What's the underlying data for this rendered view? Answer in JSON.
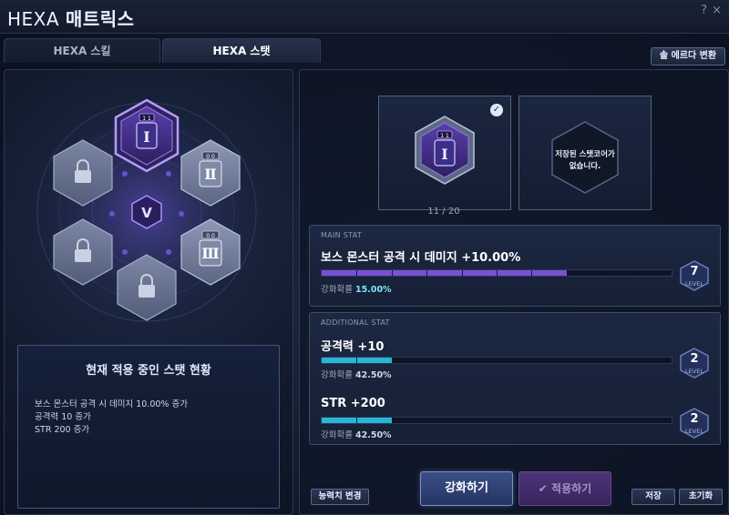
{
  "window": {
    "title_prefix": "HEXA",
    "title_main": "매트릭스",
    "help": "?",
    "close": "×"
  },
  "tabs": [
    {
      "label": "HEXA 스킬",
      "active": false
    },
    {
      "label": "HEXA 스탯",
      "active": true
    }
  ],
  "top_right_button": "솔 에르다 변환",
  "hex_grid": {
    "center_badge": "V",
    "cores": [
      {
        "slot": "top",
        "state": "selected",
        "level_tag": "1 1",
        "numeral": "Ⅰ"
      },
      {
        "slot": "upper-right",
        "state": "unlocked",
        "level_tag": "0 0",
        "numeral": "Ⅱ"
      },
      {
        "slot": "lower-right",
        "state": "unlocked",
        "level_tag": "0 0",
        "numeral": "Ⅲ"
      },
      {
        "slot": "bottom",
        "state": "locked"
      },
      {
        "slot": "lower-left",
        "state": "locked"
      },
      {
        "slot": "upper-left",
        "state": "locked"
      }
    ]
  },
  "status": {
    "title": "현재 적용 중인 스탯 현황",
    "lines": [
      "보스 몬스터 공격 시 데미지 10.00% 증가",
      "공격력 10 증가",
      "STR 200 증가"
    ]
  },
  "slots": {
    "current": {
      "level_tag": "1 1",
      "numeral": "Ⅰ",
      "checked": true
    },
    "saved_empty_text_1": "저장된 스탯코어가",
    "saved_empty_text_2": "없습니다.",
    "count": "11 / 20"
  },
  "main_stat": {
    "section_label": "MAIN STAT",
    "name": "보스 몬스터 공격 시 데미지 +10.00%",
    "rate_label": "강화확률",
    "rate_value": "15.00%",
    "level": "7",
    "level_label": "LEVEL",
    "progress": 0.7,
    "color": "#7b4fd6"
  },
  "additional_stat": {
    "section_label": "ADDITIONAL STAT",
    "stats": [
      {
        "name": "공격력",
        "value": "+10",
        "rate_label": "강화확률",
        "rate_value": "42.50%",
        "level": "2",
        "level_label": "LEVEL",
        "progress": 0.2
      },
      {
        "name": "STR",
        "value": "+200",
        "rate_label": "강화확률",
        "rate_value": "42.50%",
        "level": "2",
        "level_label": "LEVEL",
        "progress": 0.2
      }
    ],
    "color": "#28b6d6"
  },
  "buttons": {
    "ability_change": "능력치 변경",
    "enhance": "강화하기",
    "apply": "적용하기",
    "save": "저장",
    "reset": "초기화"
  }
}
